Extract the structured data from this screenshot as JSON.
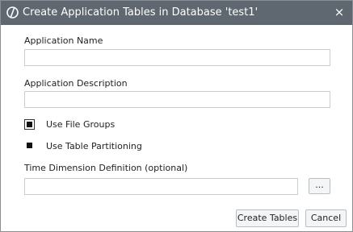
{
  "dialog": {
    "title": "Create Application Tables in Database 'test1'",
    "close_label": "×",
    "title_bar_color": "#5f6870"
  },
  "form": {
    "application_name": {
      "label": "Application Name",
      "value": ""
    },
    "application_description": {
      "label": "Application Description",
      "value": ""
    },
    "use_file_groups": {
      "label": "Use File Groups",
      "checked": true
    },
    "use_table_partitioning": {
      "label": "Use Table Partitioning",
      "checked": true
    },
    "time_dimension": {
      "label": "Time Dimension Definition (optional)",
      "value": "",
      "browse_label": "..."
    }
  },
  "buttons": {
    "create_tables": "Create Tables",
    "cancel": "Cancel"
  }
}
